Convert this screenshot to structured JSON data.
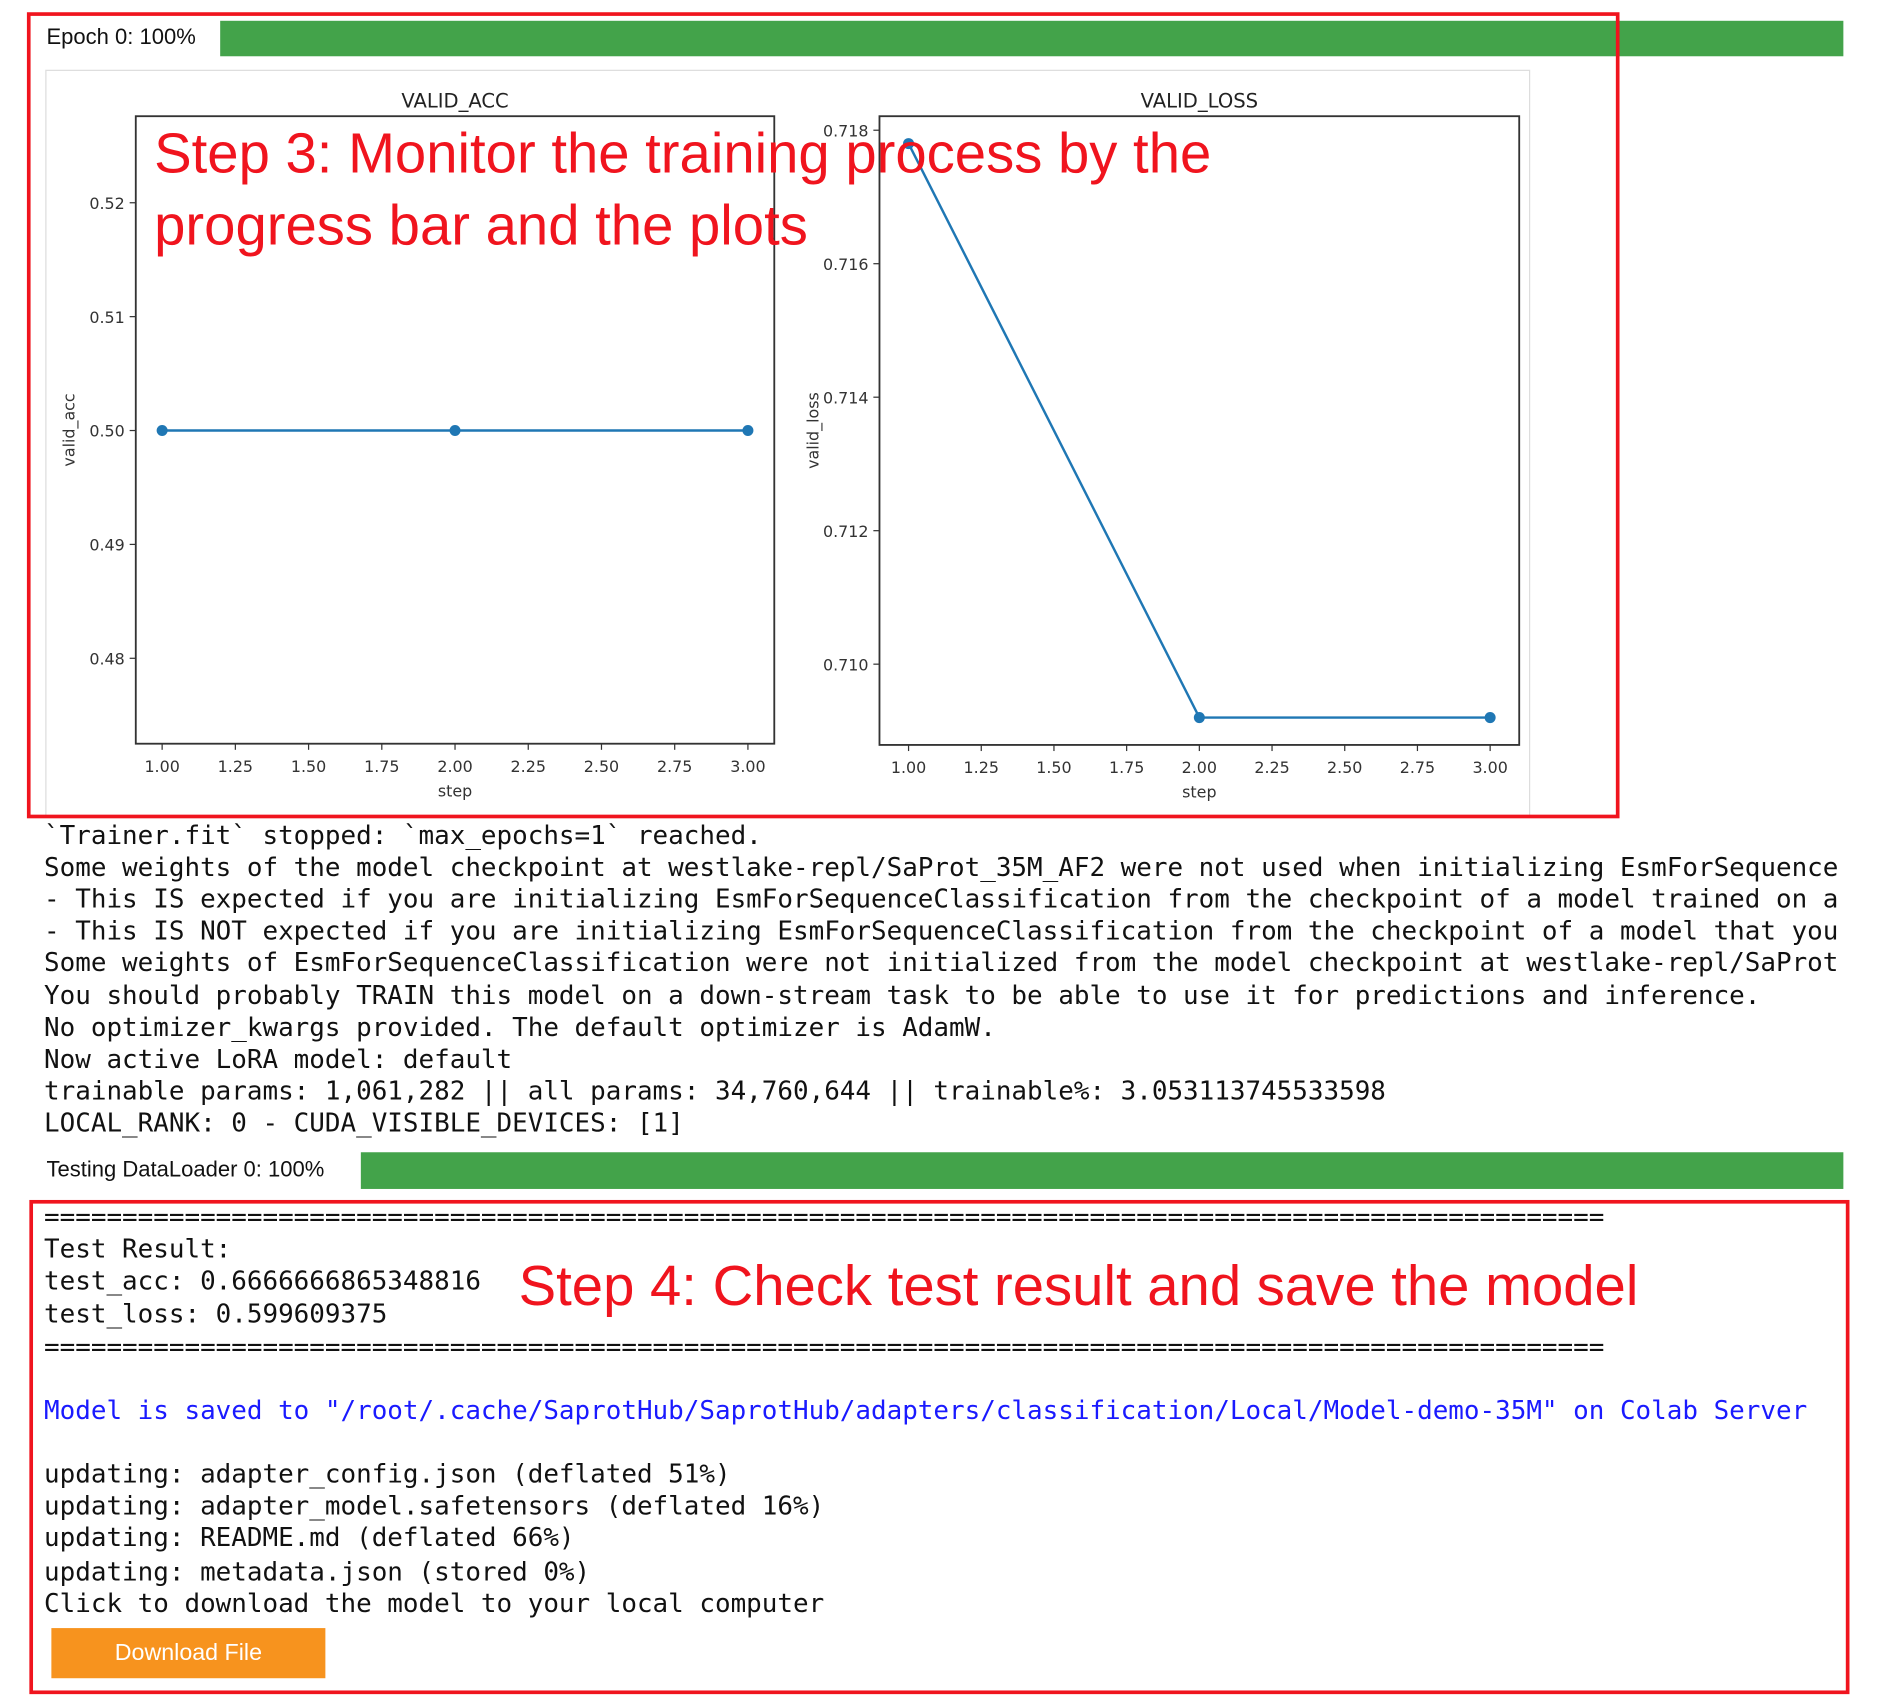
{
  "training": {
    "epoch_label": "Epoch 0: 100%",
    "epoch_progress_percent": 100
  },
  "chart_data": [
    {
      "type": "line",
      "title": "VALID_ACC",
      "xlabel": "step",
      "ylabel": "valid_acc",
      "x": [
        1,
        2,
        3
      ],
      "y": [
        0.5,
        0.5,
        0.5
      ],
      "xlim": [
        0.91,
        3.09
      ],
      "ylim": [
        0.4725,
        0.5276
      ],
      "xticks": [
        "1.00",
        "1.25",
        "1.50",
        "1.75",
        "2.00",
        "2.25",
        "2.50",
        "2.75",
        "3.00"
      ],
      "yticks": [
        "0.48",
        "0.49",
        "0.50",
        "0.51",
        "0.52"
      ],
      "color": "#1f77b4",
      "grid": false
    },
    {
      "type": "line",
      "title": "VALID_LOSS",
      "xlabel": "step",
      "ylabel": "valid_loss",
      "x": [
        1,
        2,
        3
      ],
      "y": [
        0.7178,
        0.7092,
        0.7092
      ],
      "xlim": [
        0.9,
        3.1
      ],
      "ylim": [
        0.70879,
        0.71821
      ],
      "xticks": [
        "1.00",
        "1.25",
        "1.50",
        "1.75",
        "2.00",
        "2.25",
        "2.50",
        "2.75",
        "3.00"
      ],
      "yticks": [
        "0.710",
        "0.712",
        "0.714",
        "0.716",
        "0.718"
      ],
      "color": "#1f77b4",
      "grid": false
    }
  ],
  "log_lines": [
    "`Trainer.fit` stopped: `max_epochs=1` reached.",
    "Some weights of the model checkpoint at westlake-repl/SaProt_35M_AF2 were not used when initializing EsmForSequence",
    "- This IS expected if you are initializing EsmForSequenceClassification from the checkpoint of a model trained on a",
    "- This IS NOT expected if you are initializing EsmForSequenceClassification from the checkpoint of a model that you",
    "Some weights of EsmForSequenceClassification were not initialized from the model checkpoint at westlake-repl/SaProt",
    "You should probably TRAIN this model on a down-stream task to be able to use it for predictions and inference.",
    "No optimizer_kwargs provided. The default optimizer is AdamW.",
    "Now active LoRA model: default",
    "trainable params: 1,061,282 || all params: 34,760,644 || trainable%: 3.053113745533598",
    "LOCAL_RANK: 0 - CUDA_VISIBLE_DEVICES: [1]"
  ],
  "testing": {
    "label": "Testing DataLoader 0: 100%",
    "progress_percent": 100
  },
  "results": {
    "separator": "====================================================================================================",
    "heading": "Test Result:",
    "test_acc": "test_acc: 0.6666666865348816",
    "test_loss": "test_loss: 0.599609375",
    "saved_message": "Model is saved to \"/root/.cache/SaprotHub/SaprotHub/adapters/classification/Local/Model-demo-35M\" on Colab Server",
    "updates": [
      "updating: adapter_config.json (deflated 51%)",
      "updating: adapter_model.safetensors (deflated 16%)",
      "updating: README.md (deflated 66%)",
      "updating: metadata.json (stored 0%)"
    ],
    "download_prompt": "Click to download the model to your local computer",
    "download_button": "Download File"
  },
  "annotations": {
    "step3_line1": "Step 3: Monitor the training process by the",
    "step3_line2": "progress bar and the plots",
    "step4": "Step 4: Check test result and save the model"
  },
  "colors": {
    "progress": "#43a34a",
    "annotation": "#f0141e",
    "link_text": "#1a1aff",
    "button": "#f7931e"
  }
}
